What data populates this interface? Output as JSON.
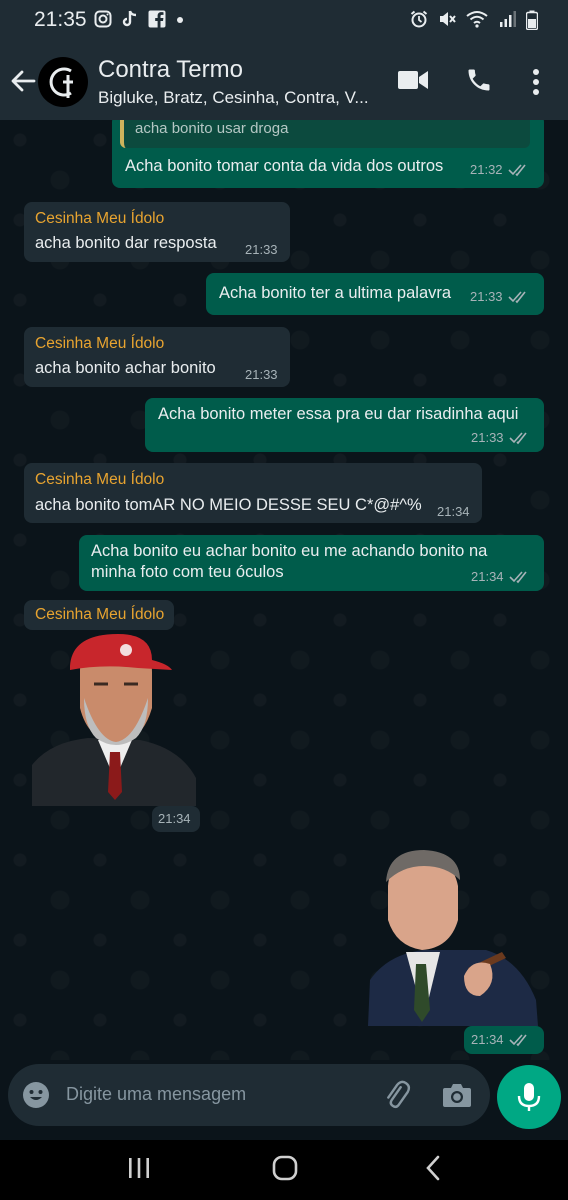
{
  "status_bar": {
    "time": "21:35",
    "left_icons": [
      "instagram-icon",
      "tiktok-icon",
      "facebook-icon",
      "dot-icon"
    ],
    "right_icons": [
      "alarm-icon",
      "mute-icon",
      "wifi-icon",
      "signal-icon",
      "battery-icon"
    ]
  },
  "header": {
    "title": "Contra Termo",
    "subtitle": "Bigluke, Bratz, Cesinha, Contra, V...",
    "icons": [
      "back-arrow-icon",
      "video-call-icon",
      "phone-icon",
      "more-vert-icon"
    ]
  },
  "messages": [
    {
      "direction": "out",
      "quote": "acha bonito usar droga",
      "text": "Acha bonito tomar conta da vida dos outros",
      "time": "21:32",
      "status": "read"
    },
    {
      "direction": "in",
      "sender": "Cesinha Meu Ídolo",
      "text": "acha bonito dar resposta",
      "time": "21:33"
    },
    {
      "direction": "out",
      "text": "Acha bonito ter a ultima palavra",
      "time": "21:33",
      "status": "read"
    },
    {
      "direction": "in",
      "sender": "Cesinha Meu Ídolo",
      "text": "acha bonito achar bonito",
      "time": "21:33"
    },
    {
      "direction": "out",
      "text": "Acha bonito meter essa pra eu dar risadinha aqui",
      "time": "21:33",
      "status": "read"
    },
    {
      "direction": "in",
      "sender": "Cesinha Meu Ídolo",
      "text": "acha bonito tomAR NO MEIO DESSE SEU C*@#^%",
      "time": "21:34"
    },
    {
      "direction": "out",
      "lines": [
        "Acha bonito eu achar bonito eu me achando bonito na",
        "minha foto com teu óculos"
      ],
      "time": "21:34",
      "status": "read"
    },
    {
      "direction": "in",
      "sender": "Cesinha Meu Ídolo",
      "type": "sticker",
      "time": "21:34"
    },
    {
      "direction": "out",
      "type": "sticker",
      "time": "21:34",
      "status": "read"
    }
  ],
  "composer": {
    "placeholder": "Digite uma mensagem",
    "icons": [
      "emoji-icon",
      "attach-icon",
      "camera-icon",
      "mic-icon"
    ]
  },
  "nav_bar": {
    "icons": [
      "recent-apps-icon",
      "home-icon",
      "back-icon"
    ]
  },
  "colors": {
    "header_bg": "#1f2c34",
    "chat_bg": "#0b141a",
    "incoming_bubble": "#1f2c34",
    "outgoing_bubble": "#005c4b",
    "sender_name": "#e8a430",
    "accent": "#00a884"
  }
}
